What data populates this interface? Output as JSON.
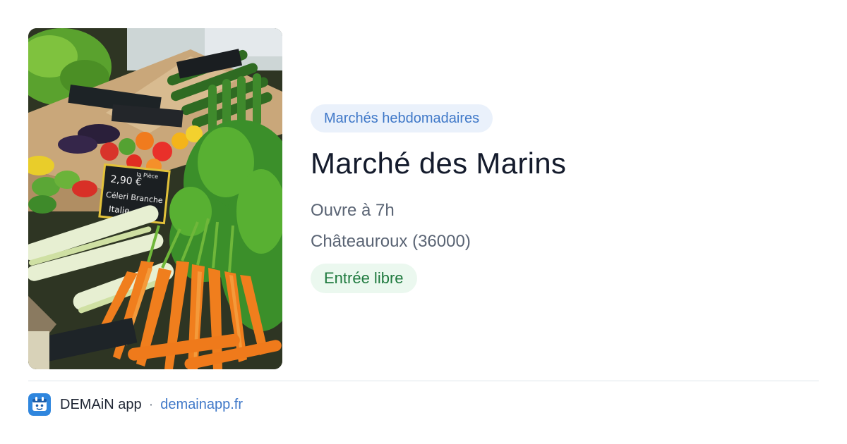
{
  "listing": {
    "category": "Marchés hebdomadaires",
    "title": "Marché des Marins",
    "hours": "Ouvre à 7h",
    "location": "Châteauroux (36000)",
    "entry": "Entrée libre"
  },
  "photo": {
    "subject": "vegetable-market-stall",
    "price_sign_lines": [
      "la Pièce",
      "2,90 €",
      "Céleri Branche",
      "Italie"
    ]
  },
  "footer": {
    "app_icon": "app-logo-icon",
    "app_name": "DEMAiN app",
    "separator": "·",
    "domain": "demainapp.fr"
  },
  "colors": {
    "category_text": "#3f78c8",
    "category_bg": "#eaf1fb",
    "title_text": "#141b2c",
    "meta_text": "#5a6474",
    "entry_text": "#1f7a3f",
    "entry_bg": "#ebf8ef",
    "link": "#3f78c8",
    "app_icon_bg": "#2f86de"
  }
}
